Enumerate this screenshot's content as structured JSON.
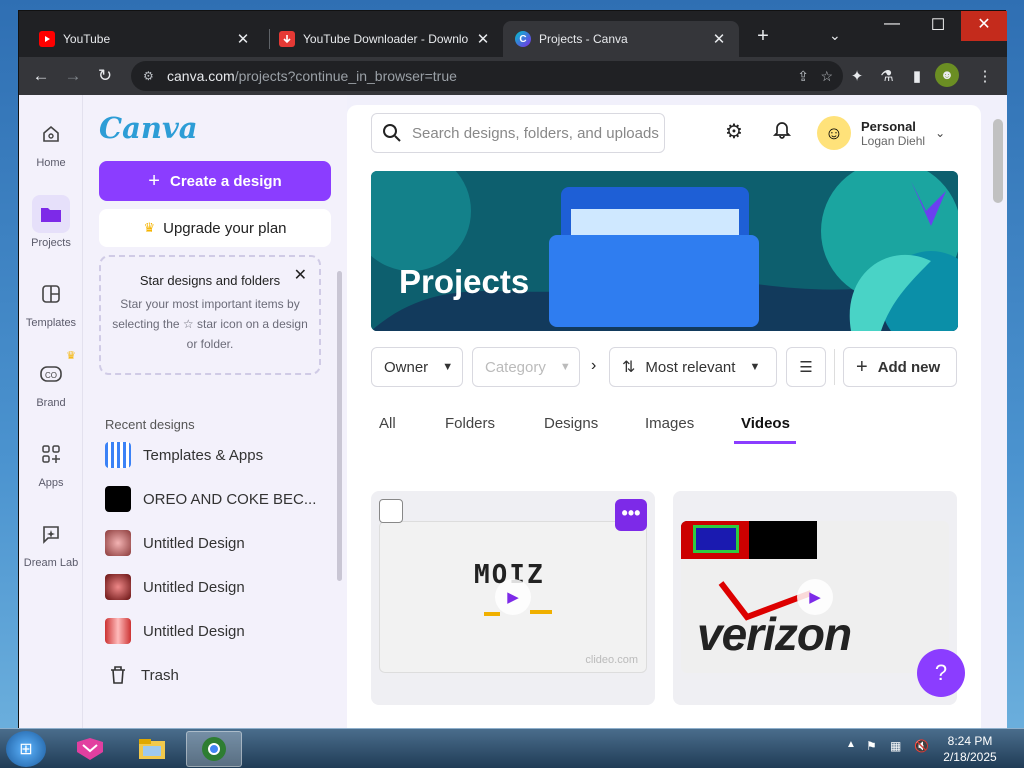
{
  "browser": {
    "tabs": [
      {
        "title": "YouTube",
        "favicon": "youtube-icon",
        "color": "#ff0000"
      },
      {
        "title": "YouTube Downloader - Downlo",
        "favicon": "downloader-icon",
        "color": "#e53935"
      },
      {
        "title": "Projects - Canva",
        "favicon": "canva-icon",
        "color": "#7d2ae8"
      }
    ],
    "url_host": "canva.com",
    "url_rest": "/projects?continue_in_browser=true"
  },
  "rail": [
    {
      "label": "Home",
      "icon": "home-icon"
    },
    {
      "label": "Projects",
      "icon": "folder-icon"
    },
    {
      "label": "Templates",
      "icon": "templates-icon"
    },
    {
      "label": "Brand",
      "icon": "brand-icon"
    },
    {
      "label": "Apps",
      "icon": "apps-icon"
    },
    {
      "label": "Dream Lab",
      "icon": "dream-lab-icon"
    }
  ],
  "sidebar": {
    "logo": "Canva",
    "create_label": "Create a design",
    "upgrade_label": "Upgrade your plan",
    "star_title": "Star designs and folders",
    "star_body": "Star your most important items by selecting the ☆ star icon on a design or folder.",
    "recent_heading": "Recent designs",
    "recent": [
      {
        "label": "Templates & Apps"
      },
      {
        "label": "OREO AND COKE BEC..."
      },
      {
        "label": "Untitled Design"
      },
      {
        "label": "Untitled Design"
      },
      {
        "label": "Untitled Design"
      }
    ],
    "trash_label": "Trash"
  },
  "header": {
    "search_placeholder": "Search designs, folders, and uploads",
    "account_name": "Personal",
    "account_user": "Logan Diehl"
  },
  "banner_title": "Projects",
  "filters": {
    "owner": "Owner",
    "category": "Category",
    "sort": "Most relevant",
    "add_new": "Add new"
  },
  "content_tabs": [
    "All",
    "Folders",
    "Designs",
    "Images",
    "Videos"
  ],
  "active_tab": "Videos",
  "cards": [
    {
      "thumb_text": "MOIZ",
      "watermark": "clideo.com"
    },
    {
      "thumb_text": "verizon"
    }
  ],
  "help_label": "?",
  "taskbar": {
    "time": "8:24 PM",
    "date": "2/18/2025"
  }
}
